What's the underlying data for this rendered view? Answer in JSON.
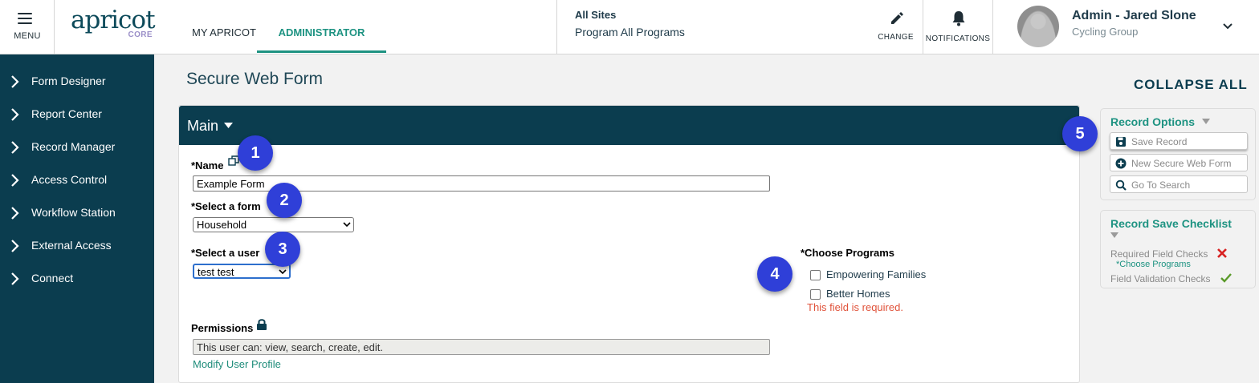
{
  "header": {
    "menu_label": "MENU",
    "logo_word": "apricot",
    "logo_sub": "CORE",
    "tabs": [
      {
        "label": "MY APRICOT"
      },
      {
        "label": "ADMINISTRATOR"
      }
    ],
    "site_title": "All Sites",
    "site_program": "Program All Programs",
    "change_label": "CHANGE",
    "notifications_label": "NOTIFICATIONS",
    "user_name": "Admin - Jared Slone",
    "user_group": "Cycling Group"
  },
  "sidebar": {
    "items": [
      {
        "label": "Form Designer"
      },
      {
        "label": "Report Center"
      },
      {
        "label": "Record Manager"
      },
      {
        "label": "Access Control"
      },
      {
        "label": "Workflow Station"
      },
      {
        "label": "External Access"
      },
      {
        "label": "Connect"
      }
    ]
  },
  "main": {
    "page_title": "Secure Web Form",
    "collapse_all": "COLLAPSE ALL",
    "section_title": "Main",
    "name_label": "*Name",
    "name_value": "Example Form",
    "form_label": "*Select a form",
    "form_value": "Household",
    "user_label": "*Select a user",
    "user_value": "test test",
    "permissions_label": "Permissions",
    "permissions_value": "This user can: view, search, create, edit.",
    "modify_link": "Modify User Profile",
    "programs_label": "*Choose Programs",
    "programs": [
      {
        "label": "Empowering Families",
        "checked": false
      },
      {
        "label": "Better Homes",
        "checked": false
      }
    ],
    "programs_error": "This field is required."
  },
  "badges": [
    "1",
    "2",
    "3",
    "4",
    "5"
  ],
  "record_options": {
    "title": "Record Options",
    "buttons": [
      {
        "label": "Save Record",
        "icon": "floppy-disk-icon"
      },
      {
        "label": "New Secure Web Form",
        "icon": "plus-circle-icon"
      },
      {
        "label": "Go To Search",
        "icon": "search-icon"
      }
    ]
  },
  "checklist": {
    "title": "Record Save Checklist",
    "required_label": "Required Field Checks",
    "required_detail": "*Choose Programs",
    "validation_label": "Field Validation Checks"
  },
  "colors": {
    "navy": "#0b3d4f",
    "teal": "#1e9382",
    "badge": "#2f3fd8",
    "error": "#e0533b"
  }
}
